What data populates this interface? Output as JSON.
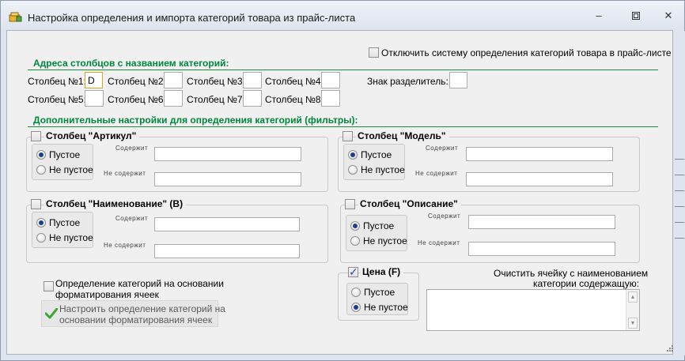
{
  "window": {
    "title": "Настройка определения и импорта категорий товара из прайс-листа"
  },
  "disable_system": {
    "label": "Отключить систему определения категорий товара в прайс-листе",
    "checked": false
  },
  "columns_section": {
    "header": "Адреса столбцов с названием категорий:",
    "fields": [
      {
        "label": "Столбец №1:",
        "value": "D"
      },
      {
        "label": "Столбец №2:",
        "value": ""
      },
      {
        "label": "Столбец №3:",
        "value": ""
      },
      {
        "label": "Столбец №4:",
        "value": ""
      },
      {
        "label": "Столбец №5:",
        "value": ""
      },
      {
        "label": "Столбец №6:",
        "value": ""
      },
      {
        "label": "Столбец №7:",
        "value": ""
      },
      {
        "label": "Столбец №8:",
        "value": ""
      }
    ],
    "separator_label": "Знак разделитель:",
    "separator_value": ""
  },
  "filters_section": {
    "header": "Дополнительные настройки для определения категорий (фильтры):"
  },
  "groups": {
    "article": {
      "title": "Столбец \"Артикул\"",
      "checked": false,
      "empty": "Пустое",
      "not_empty": "Не пустое",
      "contains": "Содержит",
      "not_contains": "Не содержит",
      "contains_value": "",
      "not_contains_value": "",
      "selected": "empty"
    },
    "model": {
      "title": "Столбец \"Модель\"",
      "checked": false,
      "empty": "Пустое",
      "not_empty": "Не пустое",
      "contains": "Содержит",
      "not_contains": "Не содержит",
      "contains_value": "",
      "not_contains_value": "",
      "selected": "empty"
    },
    "name": {
      "title": "Столбец \"Наименование\" (B)",
      "checked": false,
      "empty": "Пустое",
      "not_empty": "Не пустое",
      "contains": "Содержит",
      "not_contains": "Не содержит",
      "contains_value": "",
      "not_contains_value": "",
      "selected": "empty"
    },
    "description": {
      "title": "Столбец \"Описание\"",
      "checked": false,
      "empty": "Пустое",
      "not_empty": "Не пустое",
      "contains": "Содержит",
      "not_contains": "Не содержит",
      "contains_value": "",
      "not_contains_value": "",
      "selected": "empty"
    },
    "price": {
      "title": "Цена (F)",
      "checked": true,
      "empty": "Пустое",
      "not_empty": "Не пустое",
      "selected": "not_empty"
    }
  },
  "formatting": {
    "checkbox_label_line1": "Определение категорий на основании",
    "checkbox_label_line2": "форматирования ячеек",
    "checked": false,
    "button_line1": "Настроить определение категорий на",
    "button_line2": "основании форматирования ячеек"
  },
  "clear_cell": {
    "label_line1": "Очистить ячейку с наименованием",
    "label_line2": "категории содержащую:",
    "value": ""
  },
  "colors": {
    "section_header": "#00873b",
    "focus_border": "#e3a21a"
  }
}
